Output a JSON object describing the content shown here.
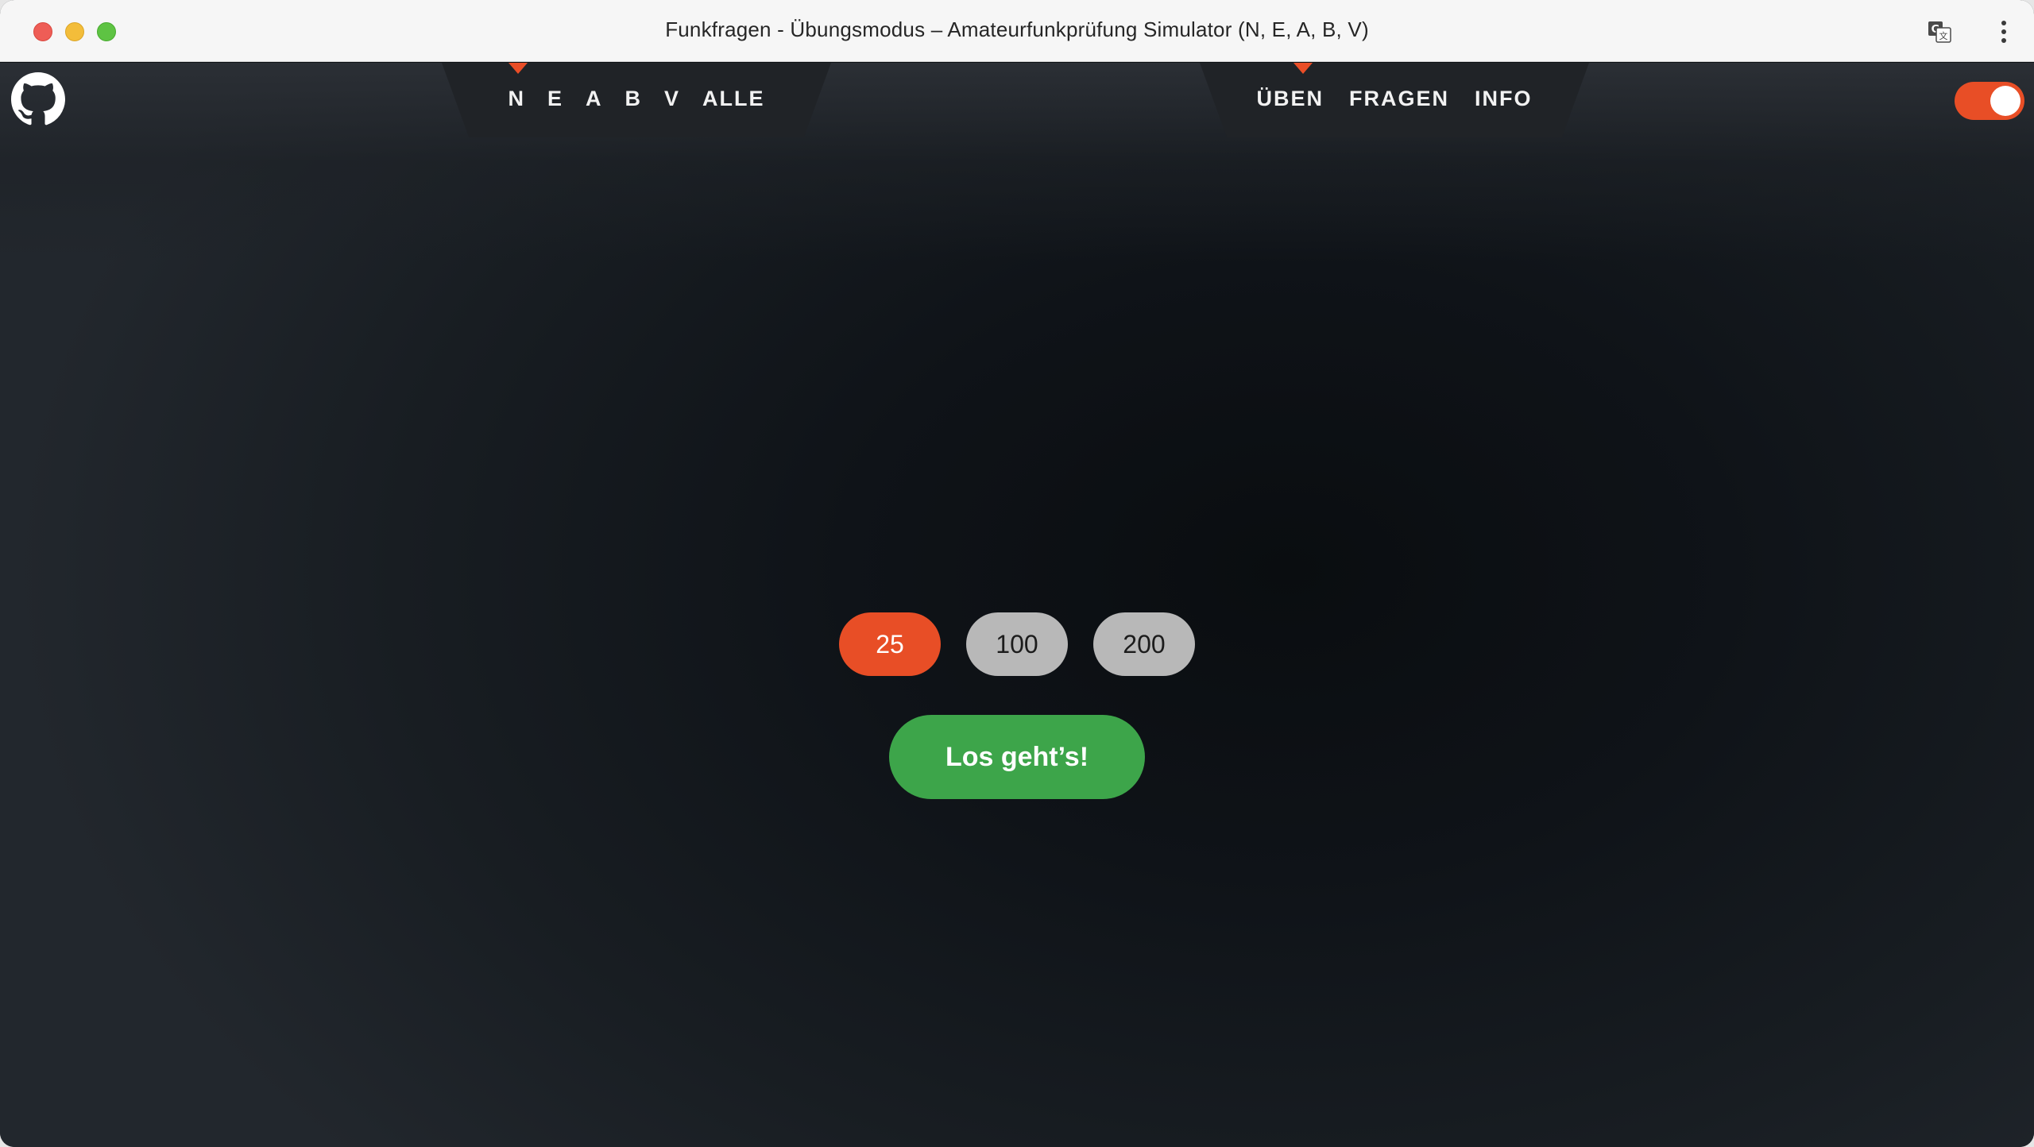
{
  "window": {
    "title": "Funkfragen - Übungsmodus – Amateurfunkprüfung Simulator (N, E, A, B, V)"
  },
  "icons": {
    "translate": "translate-icon",
    "menu": "kebab-menu-icon",
    "github": "github-icon"
  },
  "nav_classes": {
    "items": [
      {
        "label": "N",
        "active": true
      },
      {
        "label": "E",
        "active": false
      },
      {
        "label": "A",
        "active": false
      },
      {
        "label": "B",
        "active": false
      },
      {
        "label": "V",
        "active": false
      },
      {
        "label": "ALLE",
        "active": false
      }
    ]
  },
  "nav_modes": {
    "items": [
      {
        "label": "ÜBEN",
        "active": true
      },
      {
        "label": "FRAGEN",
        "active": false
      },
      {
        "label": "INFO",
        "active": false
      }
    ]
  },
  "theme_toggle": {
    "on": true
  },
  "question_counts": {
    "options": [
      "25",
      "100",
      "200"
    ],
    "selected": "25"
  },
  "start_button": {
    "label": "Los geht’s!"
  },
  "colors": {
    "accent": "#e84e26",
    "start": "#3da54a",
    "inactive_pill": "#b8b8b8",
    "nav_bg": "#202327"
  }
}
